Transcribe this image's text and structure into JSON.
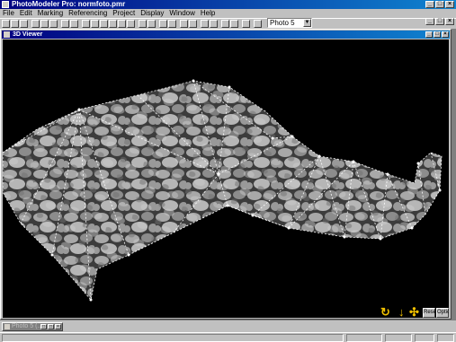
{
  "app": {
    "title": "PhotoModeler Pro: normfoto.pmr",
    "window_buttons": [
      "_",
      "□",
      "×"
    ]
  },
  "menu": {
    "items": [
      "File",
      "Edit",
      "Marking",
      "Referencing",
      "Project",
      "Display",
      "Window",
      "Help"
    ]
  },
  "toolbar": {
    "photo_select": "Photo 5",
    "dropdown_glyph": "▼"
  },
  "viewer": {
    "title": "3D Viewer",
    "window_buttons": [
      "_",
      "□",
      "×"
    ],
    "nav": {
      "rotate_glyph": "↻",
      "down_glyph": "↓",
      "move_glyph": "✣"
    },
    "reset_label": "Reset",
    "options_label": "Options"
  },
  "minimized": {
    "title": "Photo 5 (...",
    "buttons": [
      "□",
      "□",
      "×"
    ]
  },
  "colors": {
    "title_bar": "#000080",
    "viewer_background": "#000000",
    "wireframe": "#ffffff",
    "navigation": "#f0c000"
  }
}
